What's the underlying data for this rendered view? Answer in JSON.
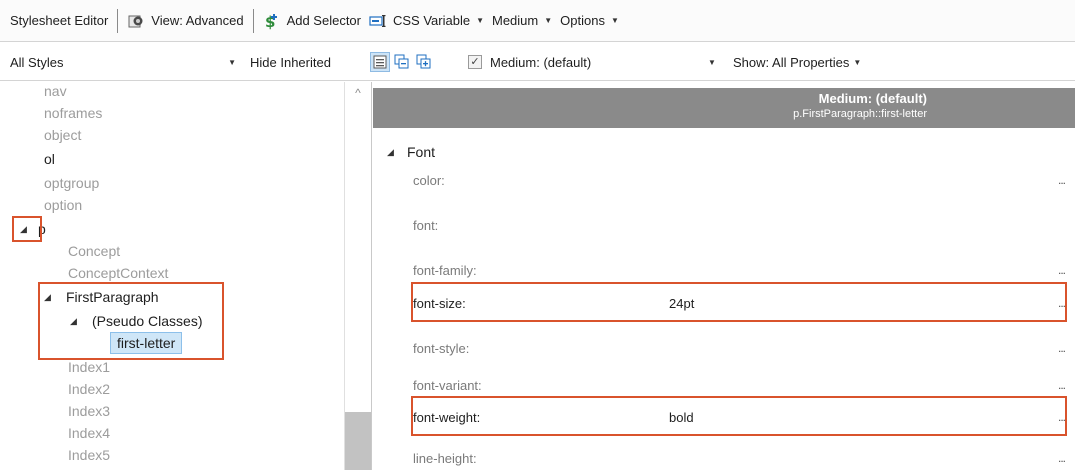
{
  "toolbar": {
    "title": "Stylesheet Editor",
    "view_label": "View: Advanced",
    "add_selector_label": "Add Selector",
    "css_variable_label": "CSS Variable",
    "medium_label": "Medium",
    "options_label": "Options"
  },
  "filterbar": {
    "styles_select_value": "All Styles",
    "hide_inherited_label": "Hide Inherited",
    "medium_checkbox_label": "Medium: (default)",
    "show_select_value": "Show: All Properties"
  },
  "tree": {
    "nodes": [
      {
        "label": "nav"
      },
      {
        "label": "noframes"
      },
      {
        "label": "object"
      },
      {
        "label": "ol"
      },
      {
        "label": "optgroup"
      },
      {
        "label": "option"
      },
      {
        "label": "p"
      },
      {
        "label": "Concept"
      },
      {
        "label": "ConceptContext"
      },
      {
        "label": "FirstParagraph"
      },
      {
        "label": "(Pseudo Classes)"
      },
      {
        "label": "first-letter"
      },
      {
        "label": "Index1"
      },
      {
        "label": "Index2"
      },
      {
        "label": "Index3"
      },
      {
        "label": "Index4"
      },
      {
        "label": "Index5"
      }
    ]
  },
  "properties": {
    "header_title": "Medium: (default)",
    "header_selector": "p.FirstParagraph::first-letter",
    "section_label": "Font",
    "rows": [
      {
        "name": "color:",
        "value": ""
      },
      {
        "name": "font:",
        "value": ""
      },
      {
        "name": "font-family:",
        "value": ""
      },
      {
        "name": "font-size:",
        "value": "24pt"
      },
      {
        "name": "font-style:",
        "value": ""
      },
      {
        "name": "font-variant:",
        "value": ""
      },
      {
        "name": "font-weight:",
        "value": "bold"
      },
      {
        "name": "line-height:",
        "value": ""
      }
    ],
    "ellipsis": "..."
  },
  "colors": {
    "highlight_box": "#d9532c",
    "selection": "#cfe6f7",
    "header_bg": "#8a8a8a"
  }
}
